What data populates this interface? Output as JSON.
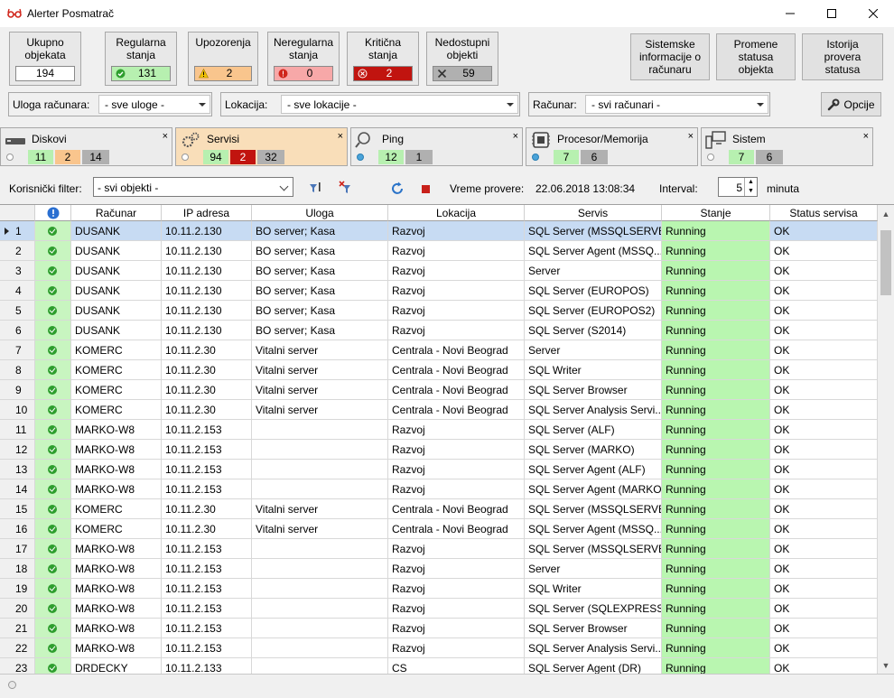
{
  "window": {
    "title": "Alerter Posmatrač"
  },
  "stats": [
    {
      "label": "Ukupno objekata",
      "value": "194",
      "color": "#ffffff",
      "icon": "none"
    },
    {
      "label": "Regularna stanja",
      "value": "131",
      "color": "#b7f0b0",
      "icon": "check-circle-icon"
    },
    {
      "label": "Upozorenja",
      "value": "2",
      "color": "#f9c58d",
      "icon": "warning-icon"
    },
    {
      "label": "Neregularna stanja",
      "value": "0",
      "color": "#f7a8a8",
      "icon": "error-icon"
    },
    {
      "label": "Kritična stanja",
      "value": "2",
      "color": "#c1140f",
      "icon": "critical-icon"
    },
    {
      "label": "Nedostupni objekti",
      "value": "59",
      "color": "#b0b0b0",
      "icon": "x-icon"
    }
  ],
  "system_buttons": [
    "Sistemske informacije o računaru",
    "Promene statusa objekta",
    "Istorija provera statusa"
  ],
  "filters": {
    "uloga_label": "Uloga računara:",
    "uloga_value": "- sve uloge -",
    "lokacija_label": "Lokacija:",
    "lokacija_value": "- sve lokacije -",
    "racunar_label": "Računar:",
    "racunar_value": "- svi računari -",
    "opcije_label": "Opcije"
  },
  "tabs": [
    {
      "name": "Diskovi",
      "icon": "disk-icon",
      "active": false,
      "dot": false,
      "counts": [
        {
          "v": "11",
          "c": "green"
        },
        {
          "v": "2",
          "c": "orange"
        },
        {
          "v": "14",
          "c": "gray"
        }
      ]
    },
    {
      "name": "Servisi",
      "icon": "gears-icon",
      "active": true,
      "dot": false,
      "counts": [
        {
          "v": "94",
          "c": "green"
        },
        {
          "v": "2",
          "c": "red"
        },
        {
          "v": "32",
          "c": "gray"
        }
      ]
    },
    {
      "name": "Ping",
      "icon": "magnifier-icon",
      "active": false,
      "dot": true,
      "counts": [
        {
          "v": "12",
          "c": "green"
        },
        {
          "v": "1",
          "c": "gray"
        }
      ]
    },
    {
      "name": "Procesor/Memorija",
      "icon": "chip-icon",
      "active": false,
      "dot": true,
      "counts": [
        {
          "v": "7",
          "c": "green"
        },
        {
          "v": "6",
          "c": "gray"
        }
      ]
    },
    {
      "name": "Sistem",
      "icon": "computer-icon",
      "active": false,
      "dot": false,
      "counts": [
        {
          "v": "7",
          "c": "green"
        },
        {
          "v": "6",
          "c": "gray"
        }
      ]
    }
  ],
  "toolbar2": {
    "filter_label": "Korisnički filter:",
    "filter_value": "- svi objekti -",
    "check_time_label": "Vreme provere:",
    "check_time_value": "22.06.2018 13:08:34",
    "interval_label": "Interval:",
    "interval_value": "5",
    "interval_unit": "minuta"
  },
  "grid": {
    "columns": [
      "Računar",
      "IP adresa",
      "Uloga",
      "Lokacija",
      "Servis",
      "Stanje",
      "Status servisa"
    ],
    "rows": [
      [
        "1",
        "DUSANK",
        "10.11.2.130",
        "BO server; Kasa",
        "Razvoj",
        "SQL Server (MSSQLSERVER)",
        "Running",
        "OK"
      ],
      [
        "2",
        "DUSANK",
        "10.11.2.130",
        "BO server; Kasa",
        "Razvoj",
        "SQL Server Agent (MSSQ...",
        "Running",
        "OK"
      ],
      [
        "3",
        "DUSANK",
        "10.11.2.130",
        "BO server; Kasa",
        "Razvoj",
        "Server",
        "Running",
        "OK"
      ],
      [
        "4",
        "DUSANK",
        "10.11.2.130",
        "BO server; Kasa",
        "Razvoj",
        "SQL Server (EUROPOS)",
        "Running",
        "OK"
      ],
      [
        "5",
        "DUSANK",
        "10.11.2.130",
        "BO server; Kasa",
        "Razvoj",
        "SQL Server (EUROPOS2)",
        "Running",
        "OK"
      ],
      [
        "6",
        "DUSANK",
        "10.11.2.130",
        "BO server; Kasa",
        "Razvoj",
        "SQL Server (S2014)",
        "Running",
        "OK"
      ],
      [
        "7",
        "KOMERC",
        "10.11.2.30",
        "Vitalni server",
        "Centrala - Novi Beograd",
        "Server",
        "Running",
        "OK"
      ],
      [
        "8",
        "KOMERC",
        "10.11.2.30",
        "Vitalni server",
        "Centrala - Novi Beograd",
        "SQL Writer",
        "Running",
        "OK"
      ],
      [
        "9",
        "KOMERC",
        "10.11.2.30",
        "Vitalni server",
        "Centrala - Novi Beograd",
        "SQL Server Browser",
        "Running",
        "OK"
      ],
      [
        "10",
        "KOMERC",
        "10.11.2.30",
        "Vitalni server",
        "Centrala - Novi Beograd",
        "SQL Server Analysis Servi...",
        "Running",
        "OK"
      ],
      [
        "11",
        "MARKO-W8",
        "10.11.2.153",
        "",
        "Razvoj",
        "SQL Server (ALF)",
        "Running",
        "OK"
      ],
      [
        "12",
        "MARKO-W8",
        "10.11.2.153",
        "",
        "Razvoj",
        "SQL Server (MARKO)",
        "Running",
        "OK"
      ],
      [
        "13",
        "MARKO-W8",
        "10.11.2.153",
        "",
        "Razvoj",
        "SQL Server Agent (ALF)",
        "Running",
        "OK"
      ],
      [
        "14",
        "MARKO-W8",
        "10.11.2.153",
        "",
        "Razvoj",
        "SQL Server Agent (MARKO)",
        "Running",
        "OK"
      ],
      [
        "15",
        "KOMERC",
        "10.11.2.30",
        "Vitalni server",
        "Centrala - Novi Beograd",
        "SQL Server (MSSQLSERVER)",
        "Running",
        "OK"
      ],
      [
        "16",
        "KOMERC",
        "10.11.2.30",
        "Vitalni server",
        "Centrala - Novi Beograd",
        "SQL Server Agent (MSSQ...",
        "Running",
        "OK"
      ],
      [
        "17",
        "MARKO-W8",
        "10.11.2.153",
        "",
        "Razvoj",
        "SQL Server (MSSQLSERVER)",
        "Running",
        "OK"
      ],
      [
        "18",
        "MARKO-W8",
        "10.11.2.153",
        "",
        "Razvoj",
        "Server",
        "Running",
        "OK"
      ],
      [
        "19",
        "MARKO-W8",
        "10.11.2.153",
        "",
        "Razvoj",
        "SQL Writer",
        "Running",
        "OK"
      ],
      [
        "20",
        "MARKO-W8",
        "10.11.2.153",
        "",
        "Razvoj",
        "SQL Server (SQLEXPRESS)",
        "Running",
        "OK"
      ],
      [
        "21",
        "MARKO-W8",
        "10.11.2.153",
        "",
        "Razvoj",
        "SQL Server Browser",
        "Running",
        "OK"
      ],
      [
        "22",
        "MARKO-W8",
        "10.11.2.153",
        "",
        "Razvoj",
        "SQL Server Analysis Servi...",
        "Running",
        "OK"
      ],
      [
        "23",
        "DRDECKY",
        "10.11.2.133",
        "",
        "CS",
        "SQL Server Agent (DR)",
        "Running",
        "OK"
      ]
    ]
  }
}
